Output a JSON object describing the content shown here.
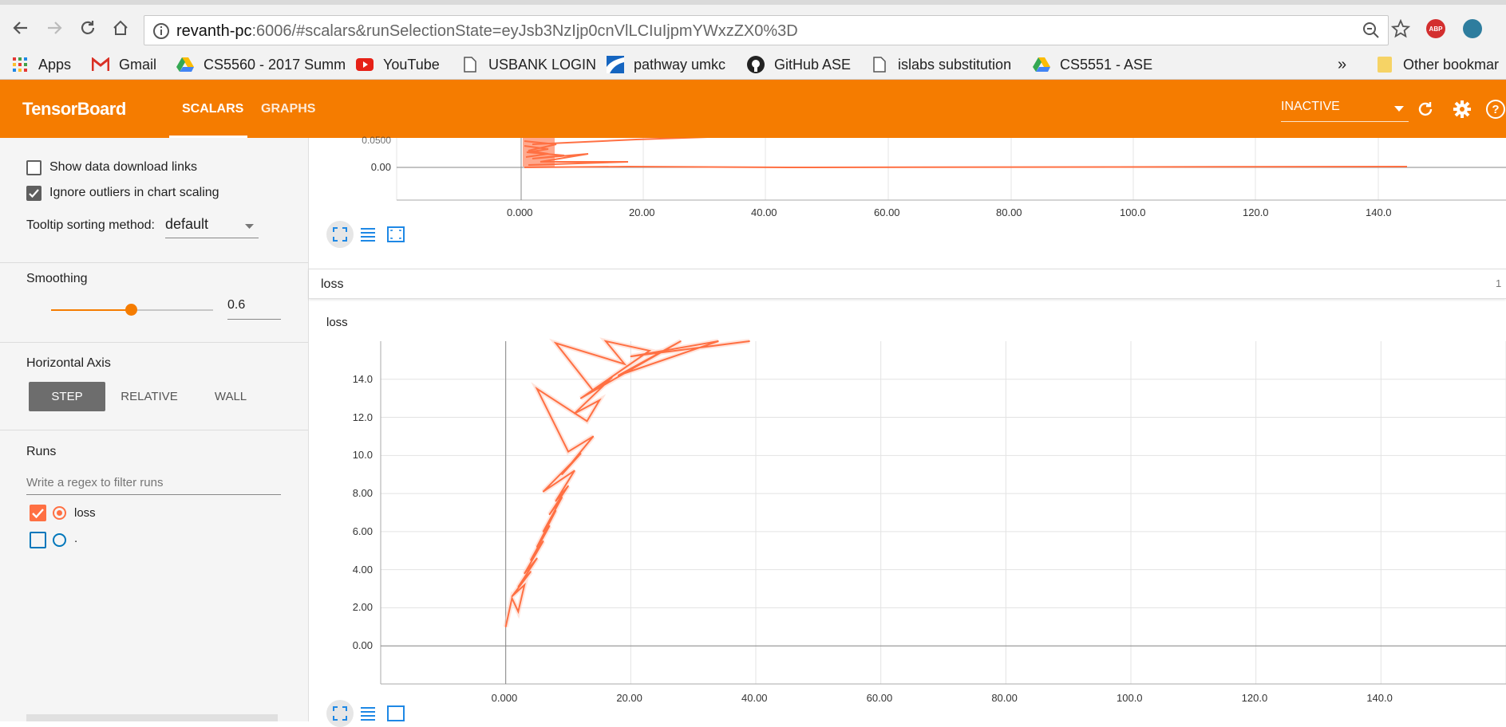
{
  "browser": {
    "url_host": "revanth-pc",
    "url_path": ":6006/#scalars&runSelectionState=eyJsb3NzIjp0cnVlLCIuIjpmYWxzZX0%3D",
    "bookmarks": [
      {
        "label": "Apps",
        "icon": "apps-grid-icon"
      },
      {
        "label": "Gmail",
        "icon": "gmail-icon"
      },
      {
        "label": "CS5560 - 2017 Summ",
        "icon": "google-drive-icon"
      },
      {
        "label": "YouTube",
        "icon": "youtube-icon"
      },
      {
        "label": "USBANK LOGIN",
        "icon": "page-icon"
      },
      {
        "label": "pathway umkc",
        "icon": "pathway-icon"
      },
      {
        "label": "GitHub ASE",
        "icon": "github-icon"
      },
      {
        "label": "islabs substitution",
        "icon": "page-icon"
      },
      {
        "label": "CS5551 - ASE",
        "icon": "google-drive-icon"
      }
    ],
    "overflow": "»",
    "other_bookmarks": "Other bookmar",
    "abp_label": "ABP"
  },
  "header": {
    "title": "TensorBoard",
    "tabs": [
      "SCALARS",
      "GRAPHS"
    ],
    "run_status": "INACTIVE",
    "accent": "#f57c00"
  },
  "sidebar": {
    "show_download_links": "Show data download links",
    "ignore_outliers": "Ignore outliers in chart scaling",
    "tooltip_label": "Tooltip sorting method:",
    "tooltip_value": "default",
    "smoothing_label": "Smoothing",
    "smoothing_value": "0.6",
    "smoothing_fraction": 0.6,
    "horizontal_axis_label": "Horizontal Axis",
    "axis_options": [
      "STEP",
      "RELATIVE",
      "WALL"
    ],
    "axis_selected": "STEP",
    "runs_label": "Runs",
    "runs_filter_placeholder": "Write a regex to filter runs",
    "runs": [
      {
        "name": "loss",
        "checked": true,
        "color": "#ff7043"
      },
      {
        "name": ".",
        "checked": false,
        "color": "#0077bb"
      }
    ]
  },
  "main": {
    "top_chart": {
      "y_tick_visible": "0.00",
      "y_tick_partial": "0.0500",
      "x_ticks": [
        "0.000",
        "20.00",
        "40.00",
        "60.00",
        "80.00",
        "100.0",
        "120.0",
        "140.0"
      ]
    },
    "group": {
      "name": "loss",
      "count": "1"
    },
    "chart_title": "loss",
    "series_color": "#ff7043"
  },
  "chart_data": {
    "type": "line",
    "title": "loss",
    "xlabel": "",
    "ylabel": "",
    "x_ticks": [
      "0.000",
      "20.00",
      "40.00",
      "60.00",
      "80.00",
      "100.0",
      "120.0",
      "140.0"
    ],
    "y_ticks": [
      "0.00",
      "2.00",
      "4.00",
      "6.00",
      "8.00",
      "10.0",
      "12.0",
      "14.0"
    ],
    "xlim": [
      -20,
      160
    ],
    "ylim": [
      -2,
      16
    ],
    "grid": true,
    "series": [
      {
        "name": "loss",
        "x": [
          0,
          1,
          2,
          3,
          1,
          4,
          2,
          5,
          3,
          6,
          4,
          7,
          5,
          8,
          6,
          9,
          7,
          10,
          8,
          11,
          6,
          12,
          9,
          14,
          10,
          5,
          13,
          15,
          11,
          17,
          14,
          8,
          19,
          16,
          23,
          12,
          28,
          18,
          34,
          20,
          39
        ],
        "y": [
          1.0,
          2.5,
          1.8,
          3.2,
          2.6,
          3.9,
          3.1,
          4.6,
          3.8,
          5.5,
          4.5,
          6.3,
          5.2,
          7.1,
          6.0,
          7.8,
          6.9,
          8.4,
          7.6,
          9.2,
          8.1,
          10.1,
          9.0,
          11.0,
          10.2,
          13.5,
          11.8,
          12.9,
          12.2,
          14.1,
          13.4,
          15.9,
          14.8,
          16.0,
          15.5,
          13.0,
          16.0,
          14.2,
          16.0,
          15.2,
          16.0
        ]
      }
    ]
  }
}
